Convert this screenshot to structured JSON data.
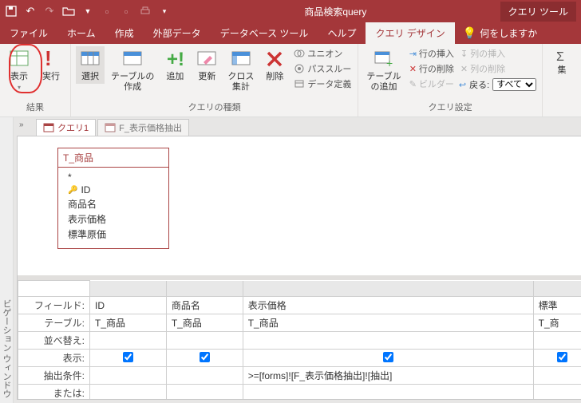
{
  "app": {
    "title": "商品検索query",
    "tool_context": "クエリ ツール"
  },
  "qat": {
    "save": "保存",
    "undo": "元に戻す",
    "redo": "やり直し"
  },
  "menu": {
    "file": "ファイル",
    "home": "ホーム",
    "create": "作成",
    "external": "外部データ",
    "dbtools": "データベース ツール",
    "help": "ヘルプ",
    "design": "クエリ デザイン",
    "tellme": "何をしますか"
  },
  "ribbon": {
    "results": {
      "label": "結果",
      "view": "表示",
      "run": "実行"
    },
    "query_type": {
      "label": "クエリの種類",
      "select": "選択",
      "make_table": "テーブルの\n作成",
      "append": "追加",
      "update": "更新",
      "crosstab": "クロス\n集計",
      "delete": "削除",
      "union": "ユニオン",
      "passthrough": "パススルー",
      "data_def": "データ定義"
    },
    "query_setup": {
      "label": "クエリ設定",
      "add_table": "テーブル\nの追加",
      "insert_row": "行の挿入",
      "delete_row": "行の削除",
      "builder": "ビルダー",
      "insert_col": "列の挿入",
      "delete_col": "列の削除",
      "return_label": "戻る:",
      "return_value": "すべて"
    },
    "sum": "集"
  },
  "tabs": {
    "q1": "クエリ1",
    "f_extract": "F_表示価格抽出"
  },
  "field_list": {
    "table": "T_商品",
    "all": "*",
    "fields": [
      "ID",
      "商品名",
      "表示価格",
      "標準原価"
    ]
  },
  "grid": {
    "rows": {
      "field": "フィールド:",
      "table": "テーブル:",
      "sort": "並べ替え:",
      "show": "表示:",
      "criteria": "抽出条件:",
      "or": "または:"
    },
    "cols": [
      {
        "field": "ID",
        "table": "T_商品",
        "show": true,
        "criteria": ""
      },
      {
        "field": "商品名",
        "table": "T_商品",
        "show": true,
        "criteria": ""
      },
      {
        "field": "表示価格",
        "table": "T_商品",
        "show": true,
        "criteria": ">=[forms]![F_表示価格抽出]![抽出]"
      },
      {
        "field": "標準",
        "table": "T_商",
        "show": true,
        "criteria": ""
      }
    ]
  },
  "nav_pane": "ビゲーション ウィンドウ"
}
